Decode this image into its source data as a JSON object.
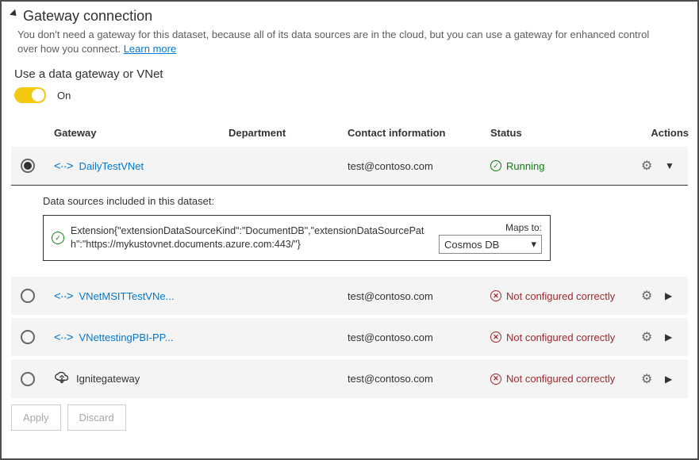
{
  "header": {
    "title": "Gateway connection",
    "description_pre": "You don't need a gateway for this dataset, because all of its data sources are in the cloud, but you can use a gateway for enhanced control over how you connect. ",
    "learn_more": "Learn more"
  },
  "gateway_section": {
    "subhead": "Use a data gateway or VNet",
    "toggle_label": "On"
  },
  "columns": {
    "gateway": "Gateway",
    "department": "Department",
    "contact": "Contact information",
    "status": "Status",
    "actions": "Actions"
  },
  "rows": [
    {
      "selected": true,
      "icon": "vnet",
      "name": "DailyTestVNet",
      "department": "",
      "contact": "test@contoso.com",
      "status_kind": "ok",
      "status_text": "Running",
      "expanded": true
    },
    {
      "selected": false,
      "icon": "vnet",
      "name": "VNetMSITTestVNe...",
      "department": "",
      "contact": "test@contoso.com",
      "status_kind": "bad",
      "status_text": "Not configured correctly",
      "expanded": false
    },
    {
      "selected": false,
      "icon": "vnet",
      "name": "VNettestingPBI-PP...",
      "department": "",
      "contact": "test@contoso.com",
      "status_kind": "bad",
      "status_text": "Not configured correctly",
      "expanded": false
    },
    {
      "selected": false,
      "icon": "cloud",
      "name": "Ignitegateway",
      "department": "",
      "contact": "test@contoso.com",
      "status_kind": "bad",
      "status_text": "Not configured correctly",
      "expanded": false
    }
  ],
  "expanded": {
    "ds_label": "Data sources included in this dataset:",
    "ds_text": "Extension{\"extensionDataSourceKind\":\"DocumentDB\",\"extensionDataSourcePath\":\"https://mykustovnet.documents.azure.com:443/\"}",
    "maps_label": "Maps to:",
    "maps_value": "Cosmos DB"
  },
  "buttons": {
    "apply": "Apply",
    "discard": "Discard"
  }
}
